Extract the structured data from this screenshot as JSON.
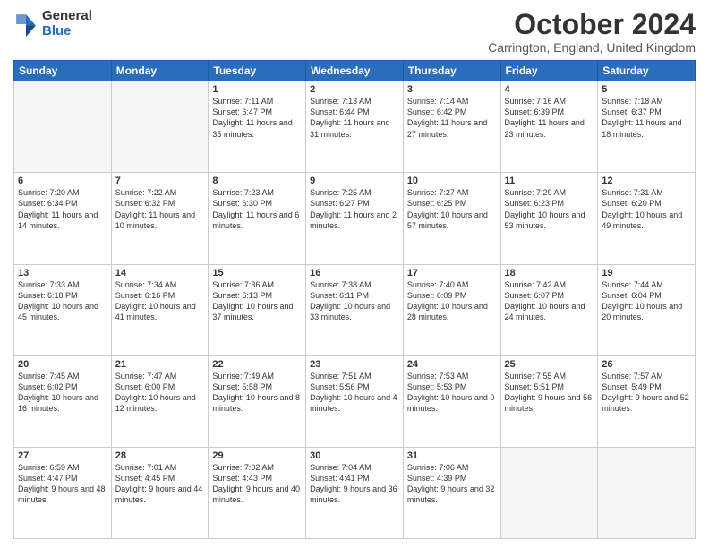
{
  "header": {
    "logo_general": "General",
    "logo_blue": "Blue",
    "month_title": "October 2024",
    "location": "Carrington, England, United Kingdom"
  },
  "days_of_week": [
    "Sunday",
    "Monday",
    "Tuesday",
    "Wednesday",
    "Thursday",
    "Friday",
    "Saturday"
  ],
  "weeks": [
    [
      {
        "day": "",
        "info": ""
      },
      {
        "day": "",
        "info": ""
      },
      {
        "day": "1",
        "info": "Sunrise: 7:11 AM\nSunset: 6:47 PM\nDaylight: 11 hours and 35 minutes."
      },
      {
        "day": "2",
        "info": "Sunrise: 7:13 AM\nSunset: 6:44 PM\nDaylight: 11 hours and 31 minutes."
      },
      {
        "day": "3",
        "info": "Sunrise: 7:14 AM\nSunset: 6:42 PM\nDaylight: 11 hours and 27 minutes."
      },
      {
        "day": "4",
        "info": "Sunrise: 7:16 AM\nSunset: 6:39 PM\nDaylight: 11 hours and 23 minutes."
      },
      {
        "day": "5",
        "info": "Sunrise: 7:18 AM\nSunset: 6:37 PM\nDaylight: 11 hours and 18 minutes."
      }
    ],
    [
      {
        "day": "6",
        "info": "Sunrise: 7:20 AM\nSunset: 6:34 PM\nDaylight: 11 hours and 14 minutes."
      },
      {
        "day": "7",
        "info": "Sunrise: 7:22 AM\nSunset: 6:32 PM\nDaylight: 11 hours and 10 minutes."
      },
      {
        "day": "8",
        "info": "Sunrise: 7:23 AM\nSunset: 6:30 PM\nDaylight: 11 hours and 6 minutes."
      },
      {
        "day": "9",
        "info": "Sunrise: 7:25 AM\nSunset: 6:27 PM\nDaylight: 11 hours and 2 minutes."
      },
      {
        "day": "10",
        "info": "Sunrise: 7:27 AM\nSunset: 6:25 PM\nDaylight: 10 hours and 57 minutes."
      },
      {
        "day": "11",
        "info": "Sunrise: 7:29 AM\nSunset: 6:23 PM\nDaylight: 10 hours and 53 minutes."
      },
      {
        "day": "12",
        "info": "Sunrise: 7:31 AM\nSunset: 6:20 PM\nDaylight: 10 hours and 49 minutes."
      }
    ],
    [
      {
        "day": "13",
        "info": "Sunrise: 7:33 AM\nSunset: 6:18 PM\nDaylight: 10 hours and 45 minutes."
      },
      {
        "day": "14",
        "info": "Sunrise: 7:34 AM\nSunset: 6:16 PM\nDaylight: 10 hours and 41 minutes."
      },
      {
        "day": "15",
        "info": "Sunrise: 7:36 AM\nSunset: 6:13 PM\nDaylight: 10 hours and 37 minutes."
      },
      {
        "day": "16",
        "info": "Sunrise: 7:38 AM\nSunset: 6:11 PM\nDaylight: 10 hours and 33 minutes."
      },
      {
        "day": "17",
        "info": "Sunrise: 7:40 AM\nSunset: 6:09 PM\nDaylight: 10 hours and 28 minutes."
      },
      {
        "day": "18",
        "info": "Sunrise: 7:42 AM\nSunset: 6:07 PM\nDaylight: 10 hours and 24 minutes."
      },
      {
        "day": "19",
        "info": "Sunrise: 7:44 AM\nSunset: 6:04 PM\nDaylight: 10 hours and 20 minutes."
      }
    ],
    [
      {
        "day": "20",
        "info": "Sunrise: 7:45 AM\nSunset: 6:02 PM\nDaylight: 10 hours and 16 minutes."
      },
      {
        "day": "21",
        "info": "Sunrise: 7:47 AM\nSunset: 6:00 PM\nDaylight: 10 hours and 12 minutes."
      },
      {
        "day": "22",
        "info": "Sunrise: 7:49 AM\nSunset: 5:58 PM\nDaylight: 10 hours and 8 minutes."
      },
      {
        "day": "23",
        "info": "Sunrise: 7:51 AM\nSunset: 5:56 PM\nDaylight: 10 hours and 4 minutes."
      },
      {
        "day": "24",
        "info": "Sunrise: 7:53 AM\nSunset: 5:53 PM\nDaylight: 10 hours and 0 minutes."
      },
      {
        "day": "25",
        "info": "Sunrise: 7:55 AM\nSunset: 5:51 PM\nDaylight: 9 hours and 56 minutes."
      },
      {
        "day": "26",
        "info": "Sunrise: 7:57 AM\nSunset: 5:49 PM\nDaylight: 9 hours and 52 minutes."
      }
    ],
    [
      {
        "day": "27",
        "info": "Sunrise: 6:59 AM\nSunset: 4:47 PM\nDaylight: 9 hours and 48 minutes."
      },
      {
        "day": "28",
        "info": "Sunrise: 7:01 AM\nSunset: 4:45 PM\nDaylight: 9 hours and 44 minutes."
      },
      {
        "day": "29",
        "info": "Sunrise: 7:02 AM\nSunset: 4:43 PM\nDaylight: 9 hours and 40 minutes."
      },
      {
        "day": "30",
        "info": "Sunrise: 7:04 AM\nSunset: 4:41 PM\nDaylight: 9 hours and 36 minutes."
      },
      {
        "day": "31",
        "info": "Sunrise: 7:06 AM\nSunset: 4:39 PM\nDaylight: 9 hours and 32 minutes."
      },
      {
        "day": "",
        "info": ""
      },
      {
        "day": "",
        "info": ""
      }
    ]
  ]
}
